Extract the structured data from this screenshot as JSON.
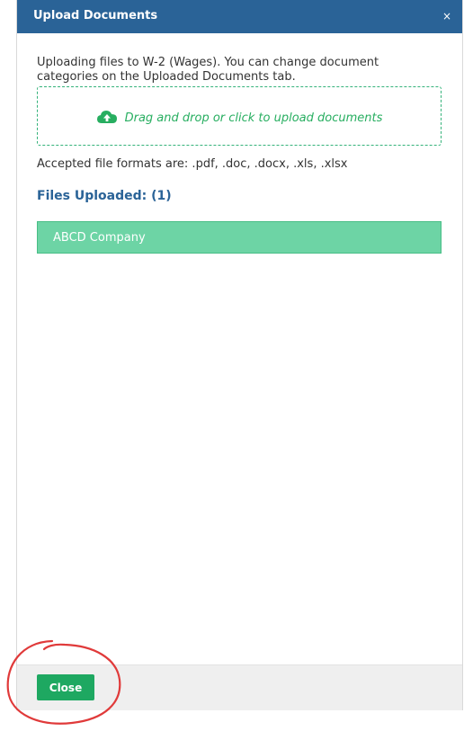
{
  "dialog": {
    "title": "Upload Documents",
    "close_symbol": "×",
    "intro_text": "Uploading files to W-2 (Wages). You can change document categories on the Uploaded Documents tab.",
    "dropzone": {
      "icon": "cloud-upload-icon",
      "label": "Drag and drop or click to upload documents"
    },
    "accepted_formats": "Accepted file formats are: .pdf, .doc, .docx, .xls, .xlsx",
    "files_heading": "Files Uploaded: (1)",
    "files": [
      {
        "name": "ABCD Company"
      }
    ],
    "footer": {
      "close_label": "Close"
    }
  },
  "colors": {
    "header": "#2a6397",
    "accent_green": "#27ae60",
    "file_bg": "#6dd4a5",
    "button": "#1ea861",
    "annotation": "#e03a3a"
  }
}
